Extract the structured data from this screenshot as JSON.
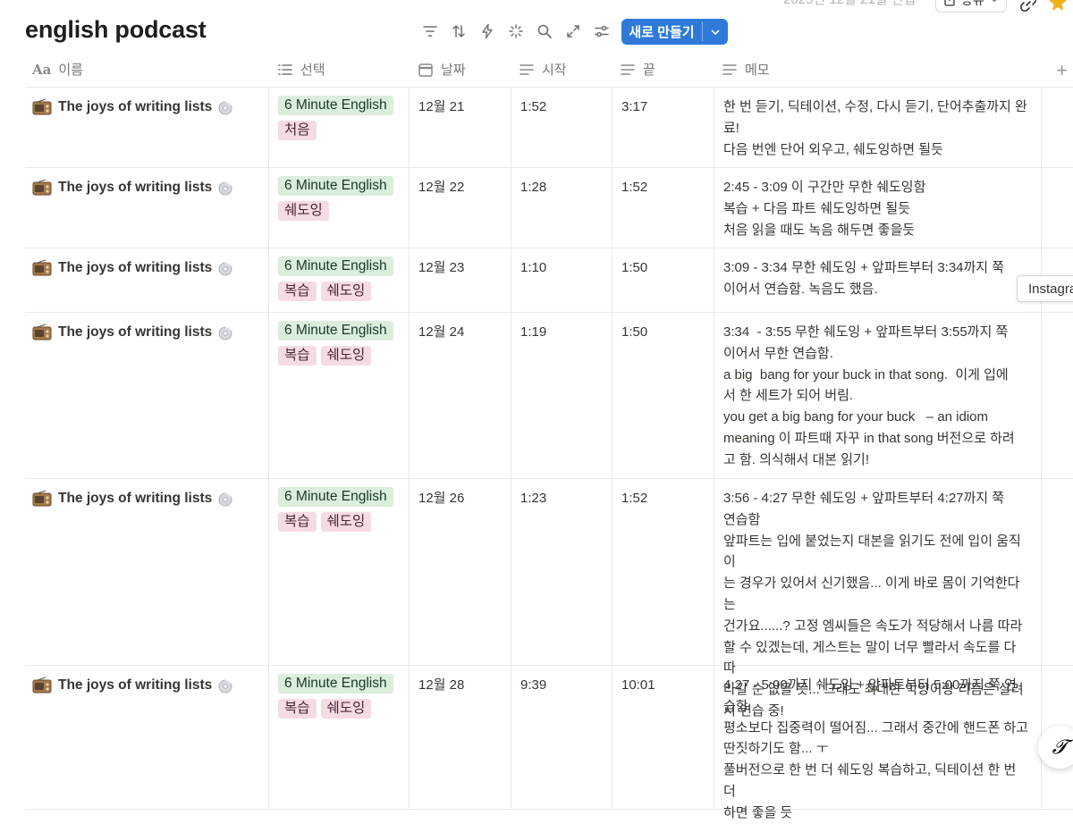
{
  "top": {
    "edited_text": "2025년 12월 21일 편집",
    "share_label": "공유"
  },
  "page": {
    "title": "english podcast",
    "new_button_label": "새로 만들기"
  },
  "columns": {
    "name": "이름",
    "select": "선택",
    "date": "날짜",
    "start": "시작",
    "end": "끝",
    "memo": "메모"
  },
  "rows": [
    {
      "name": "The joys of writing lists",
      "tags": [
        "6 Minute English",
        "처음"
      ],
      "date": "12월 21",
      "start": "1:52",
      "end": "3:17",
      "memo": [
        "한 번 듣기, 딕테이션, 수정, 다시 듣기, 단어추출까지 완",
        "료!",
        "다음 번엔 단어 외우고, 쉐도잉하면 될듯"
      ]
    },
    {
      "name": "The joys of writing lists",
      "tags": [
        "6 Minute English",
        "쉐도잉"
      ],
      "date": "12월 22",
      "start": "1:28",
      "end": "1:52",
      "memo": [
        "2:45 - 3:09 이 구간만 무한 쉐도잉함",
        "복습 + 다음 파트 쉐도잉하면 될듯",
        "처음 읽을 때도 녹음 해두면 좋을듯"
      ]
    },
    {
      "name": "The joys of writing lists",
      "tags": [
        "6 Minute English",
        "복습",
        "쉐도잉"
      ],
      "date": "12월 23",
      "start": "1:10",
      "end": "1:50",
      "memo": [
        "3:09 - 3:34 무한 쉐도잉 + 앞파트부터 3:34까지 쭉",
        "이어서 연습함. 녹음도 했음."
      ]
    },
    {
      "name": "The joys of writing lists",
      "tags": [
        "6 Minute English",
        "복습",
        "쉐도잉"
      ],
      "date": "12월 24",
      "start": "1:19",
      "end": "1:50",
      "memo": [
        "3:34  - 3:55 무한 쉐도잉 + 앞파트부터 3:55까지 쭉",
        "이어서 무한 연습함.",
        "a big  bang for your buck in that song.  이게 입에",
        "서 한 세트가 되어 버림.",
        "you get a big bang for your buck   – an idiom",
        "meaning 이 파트때 자꾸 in that song 버전으로 하려",
        "고 함. 의식해서 대본 읽기!"
      ]
    },
    {
      "name": "The joys of writing lists",
      "tags": [
        "6 Minute English",
        "복습",
        "쉐도잉"
      ],
      "date": "12월 26",
      "start": "1:23",
      "end": "1:52",
      "memo": [
        "3:56 - 4:27 무한 쉐도잉 + 앞파트부터 4:27까지 쭉",
        "연습함",
        "앞파트는 입에 붙었는지 대본을 읽기도 전에 입이 움직이",
        "는 경우가 있어서 신기했음... 이게 바로 몸이 기억한다는",
        "건가요......? 고정 엠씨들은 속도가 적당해서 나름 따라",
        "할 수 있겠는데, 게스트는 말이 너무 빨라서 속도를 다 따",
        "라갈 순 없을 듯... 그래도 최대한 억양이랑 리듬은 살려",
        "서 연습 중!"
      ]
    },
    {
      "name": "The joys of writing lists",
      "tags": [
        "6 Minute English",
        "복습",
        "쉐도잉"
      ],
      "date": "12월 28",
      "start": "9:39",
      "end": "10:01",
      "memo": [
        "4:27 - 5:00까지 쉐도잉 + 앞파트부터 5:00까지 쭉 연",
        "습함",
        "평소보다 집중력이 떨어짐... 그래서 중간에 핸드폰 하고",
        "딴짓하기도 함... ㅜ",
        "풀버전으로 한 번 더 쉐도잉 복습하고, 딕테이션 한 번 더",
        "하면 좋을 듯"
      ]
    }
  ],
  "overlay": {
    "instagram_label": "Instagram"
  }
}
